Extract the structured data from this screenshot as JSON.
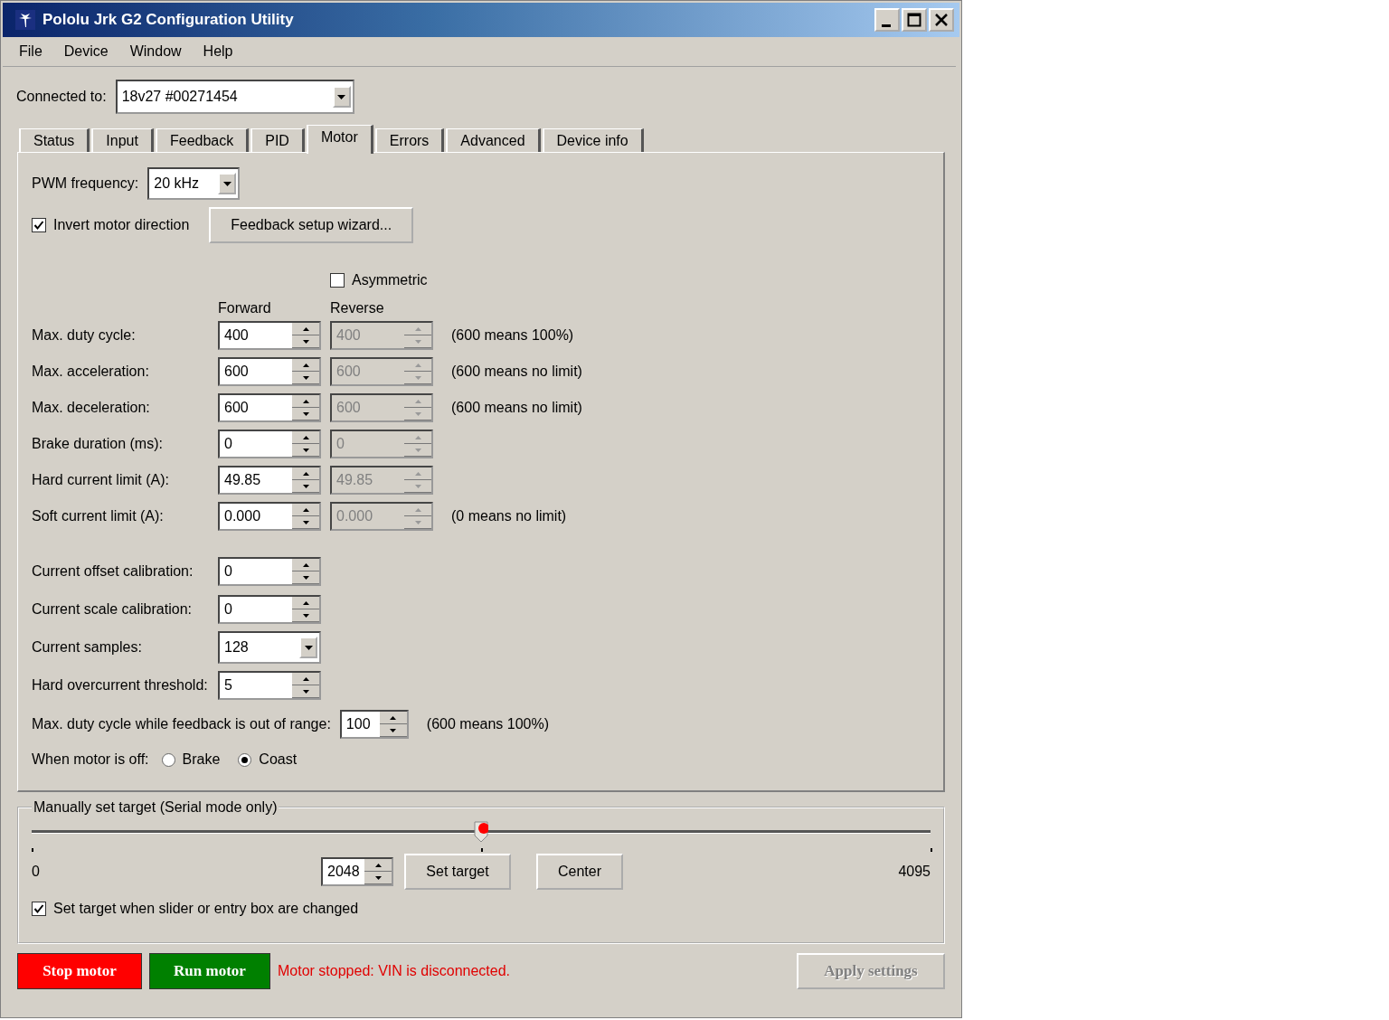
{
  "window": {
    "title": "Pololu Jrk G2 Configuration Utility"
  },
  "menu": [
    {
      "label": "File"
    },
    {
      "label": "Device"
    },
    {
      "label": "Window"
    },
    {
      "label": "Help"
    }
  ],
  "connection": {
    "label": "Connected to:",
    "value": "18v27 #00271454"
  },
  "tabs": [
    {
      "label": "Status",
      "selected": false
    },
    {
      "label": "Input",
      "selected": false
    },
    {
      "label": "Feedback",
      "selected": false
    },
    {
      "label": "PID",
      "selected": false
    },
    {
      "label": "Motor",
      "selected": true
    },
    {
      "label": "Errors",
      "selected": false
    },
    {
      "label": "Advanced",
      "selected": false
    },
    {
      "label": "Device info",
      "selected": false
    }
  ],
  "pwm_frequency": {
    "label": "PWM frequency:",
    "value": "20 kHz"
  },
  "invert_motor_direction": {
    "label": "Invert motor direction",
    "checked": true
  },
  "feedback_wizard_button": "Feedback setup wizard...",
  "asymmetric": {
    "label": "Asymmetric",
    "checked": false
  },
  "column_headers": [
    "Forward",
    "Reverse"
  ],
  "limits": [
    {
      "label": "Max. duty cycle:",
      "forward": "400",
      "reverse": "400",
      "note": "(600 means 100%)"
    },
    {
      "label": "Max. acceleration:",
      "forward": "600",
      "reverse": "600",
      "note": "(600 means no limit)"
    },
    {
      "label": "Max. deceleration:",
      "forward": "600",
      "reverse": "600",
      "note": "(600 means no limit)"
    },
    {
      "label": "Brake duration (ms):",
      "forward": "0",
      "reverse": "0"
    },
    {
      "label": "Hard current limit (A):",
      "forward": "49.85",
      "reverse": "49.85"
    },
    {
      "label": "Soft current limit (A):",
      "forward": "0.000",
      "reverse": "0.000",
      "note": "(0 means no limit)"
    }
  ],
  "calibration": [
    {
      "label": "Current offset calibration:",
      "kind": "spin",
      "value": "0"
    },
    {
      "label": "Current scale calibration:",
      "kind": "spin",
      "value": "0"
    },
    {
      "label": "Current samples:",
      "kind": "dropdown",
      "value": "128"
    },
    {
      "label": "Hard overcurrent threshold:",
      "kind": "spin",
      "value": "5"
    }
  ],
  "out_of_range_duty": {
    "label": "Max. duty cycle while feedback is out of range:",
    "value": "100",
    "note": "(600 means 100%)"
  },
  "motor_off": {
    "label": "When motor is off:",
    "options": [
      {
        "label": "Brake",
        "selected": false
      },
      {
        "label": "Coast",
        "selected": true
      }
    ]
  },
  "target": {
    "title": "Manually set target (Serial mode only)",
    "slider": {
      "level": 0.5
    },
    "min_label": "0",
    "max_label": "4095",
    "value": "2048",
    "set_button": "Set target",
    "center_button": "Center",
    "auto_set": {
      "label": "Set target when slider or entry box are changed",
      "checked": true
    }
  },
  "footer": {
    "stop_button": "Stop motor",
    "run_button": "Run motor",
    "status": "Motor stopped: VIN is disconnected.",
    "apply_button": {
      "label": "Apply settings",
      "disabled": true
    }
  }
}
